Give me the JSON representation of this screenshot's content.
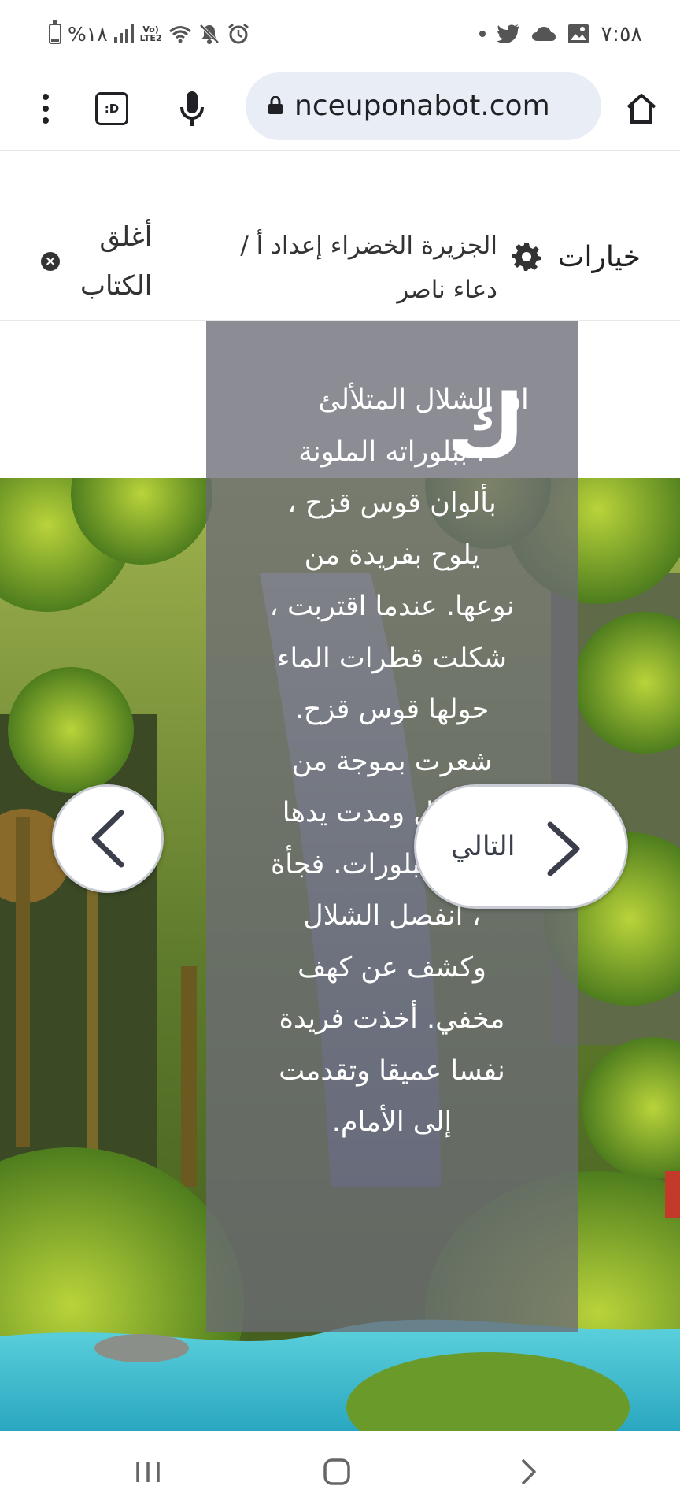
{
  "status_bar": {
    "battery_percent": "%١٨",
    "network": "LTE2",
    "time": "٧:٥٨"
  },
  "browser": {
    "url": "nceuponabot.com",
    "tab_count": ":D"
  },
  "reader": {
    "options_label": "خيارات",
    "book_title_line1": "الجزيرة الخضراء إعداد أ /",
    "book_title_line2": "دعاء ناصر",
    "close_label_line1": "أغلق",
    "close_label_line2": "الكتاب"
  },
  "story": {
    "drop_cap": "ك",
    "lines": [
      "ان الشلال المتلألئ",
      "، ببلوراته الملونة",
      "بألوان قوس قزح ،",
      "يلوح بفريدة من",
      "نوعها. عندما اقتربت ،",
      "شكلت قطرات الماء",
      "حولها قوس قزح.",
      "شعرت بموجة من",
      "الفضول ومدت يدها",
      "تلمس البلورات. فجأة",
      "، انفصل الشلال",
      "وكشف عن كهف",
      "مخفي. أخذت فريدة",
      "نفسا عميقا وتقدمت",
      "إلى الأمام."
    ]
  },
  "navigation": {
    "next_label": "التالي"
  },
  "icons": {
    "lock": "lock-icon",
    "mic": "microphone-icon",
    "home": "home-icon",
    "gear": "gear-icon",
    "close": "close-icon",
    "prev": "chevron-left-icon",
    "next": "chevron-right-icon"
  }
}
